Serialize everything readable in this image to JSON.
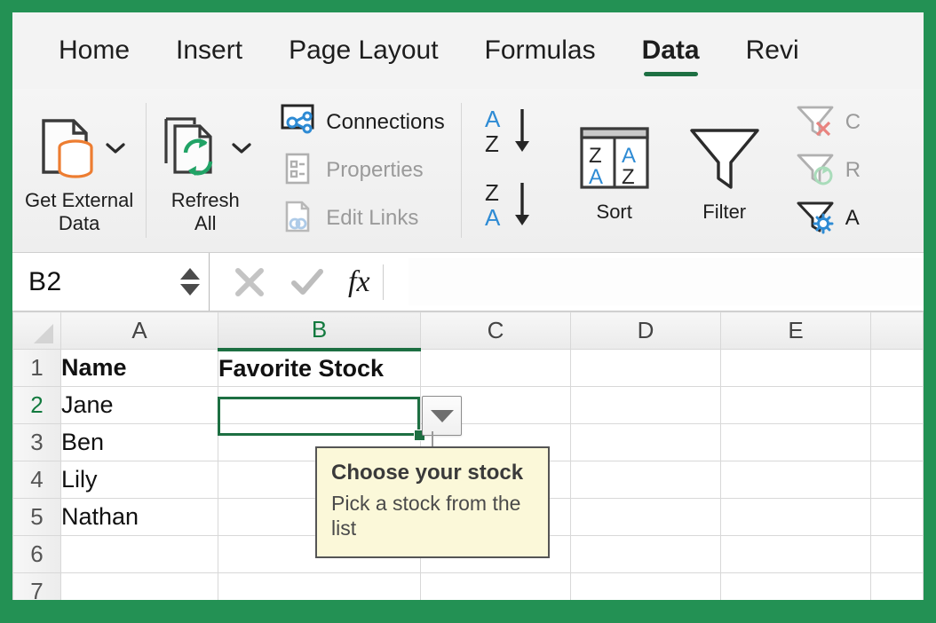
{
  "theme": {
    "excel_green": "#239154",
    "accent_green": "#1d6f42",
    "tooltip_bg": "#fbf8d9",
    "orange": "#ED7D31",
    "blue": "#2E8BD4",
    "icon_green": "#21A366"
  },
  "ribbon": {
    "tabs": [
      {
        "label": "Home",
        "active": false
      },
      {
        "label": "Insert",
        "active": false
      },
      {
        "label": "Page Layout",
        "active": false
      },
      {
        "label": "Formulas",
        "active": false
      },
      {
        "label": "Data",
        "active": true
      },
      {
        "label": "Revi",
        "active": false
      }
    ],
    "groups": {
      "get_external_data": {
        "label_line1": "Get External",
        "label_line2": "Data",
        "icon": "database-document-icon",
        "chevron": "chevron-down-icon"
      },
      "refresh_all": {
        "label_line1": "Refresh",
        "label_line2": "All",
        "icon": "refresh-documents-icon",
        "chevron": "chevron-down-icon"
      },
      "connections": [
        {
          "label": "Connections",
          "icon": "connections-icon",
          "enabled": true
        },
        {
          "label": "Properties",
          "icon": "properties-icon",
          "enabled": false
        },
        {
          "label": "Edit Links",
          "icon": "edit-links-icon",
          "enabled": false
        }
      ],
      "sort_filter": {
        "sort_az": "sort-ascending-icon",
        "sort_za": "sort-descending-icon",
        "sort_label": "Sort",
        "sort_icon": "sort-dialog-icon",
        "filter_label": "Filter",
        "filter_icon": "filter-funnel-icon"
      },
      "filter_extras": [
        {
          "label": "C",
          "icon": "clear-filter-icon",
          "enabled": false
        },
        {
          "label": "R",
          "icon": "reapply-filter-icon",
          "enabled": false
        },
        {
          "label": "A",
          "icon": "advanced-filter-icon",
          "enabled": true
        }
      ]
    }
  },
  "formula_bar": {
    "name_box_value": "B2",
    "spinner_up": "spinner-up-icon",
    "spinner_down": "spinner-down-icon",
    "cancel_icon": "cancel-x-icon",
    "confirm_icon": "confirm-check-icon",
    "function_icon": "fx",
    "input_value": "",
    "input_placeholder": ""
  },
  "sheet": {
    "columns": [
      "A",
      "B",
      "C",
      "D",
      "E",
      ""
    ],
    "selected_column": "B",
    "rows": [
      "1",
      "2",
      "3",
      "4",
      "5",
      "6",
      "7"
    ],
    "selected_row": "2",
    "selected_cell": "B2",
    "cells": {
      "A1": "Name",
      "B1": "Favorite Stock",
      "A2": "Jane",
      "B2": "",
      "A3": "Ben",
      "A4": "Lily",
      "A5": "Nathan"
    },
    "dropdown_button": "dropdown-arrow-icon"
  },
  "tooltip": {
    "title": "Choose your stock",
    "body": "Pick a stock from the list"
  }
}
